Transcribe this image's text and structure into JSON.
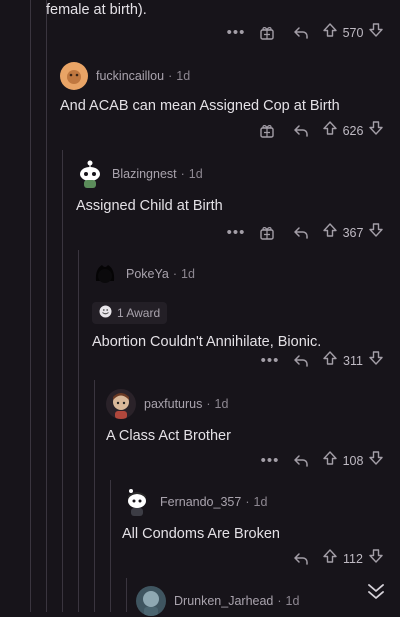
{
  "comments": [
    {
      "username": "",
      "age": "",
      "body": "female at birth).",
      "score": "570",
      "has_award_button": true
    },
    {
      "username": "fuckincaillou",
      "age": "1d",
      "body": "And ACAB can mean Assigned Cop at Birth",
      "score": "626",
      "has_award_button": true
    },
    {
      "username": "Blazingnest",
      "age": "1d",
      "body": "Assigned Child at Birth",
      "score": "367",
      "has_award_button": true
    },
    {
      "username": "PokeYa",
      "age": "1d",
      "body": "Abortion Couldn't Annihilate, Bionic.",
      "score": "311",
      "award_label": "1 Award",
      "has_award_button": false
    },
    {
      "username": "paxfuturus",
      "age": "1d",
      "body": "A Class Act Brother",
      "score": "108",
      "has_award_button": false
    },
    {
      "username": "Fernando_357",
      "age": "1d",
      "body": "All Condoms Are Broken",
      "score": "112",
      "has_award_button": false
    },
    {
      "username": "Drunken_Jarhead",
      "age": "1d",
      "body": "",
      "score": ""
    }
  ],
  "separator": "·",
  "more_label": "•••",
  "icons": {
    "more": "more-options-icon",
    "award": "award-icon",
    "reply": "reply-icon",
    "upvote": "upvote-icon",
    "downvote": "downvote-icon",
    "scroll": "chevron-double-down-icon"
  },
  "colors": {
    "background": "#17141a",
    "thread_line": "#3a353f",
    "text": "#e4e1e6",
    "muted": "#a9a3ad"
  }
}
